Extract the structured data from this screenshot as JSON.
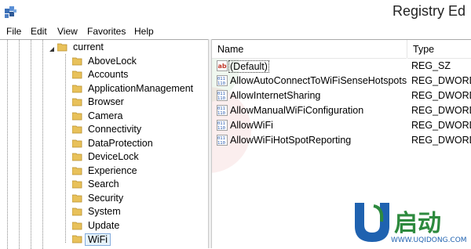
{
  "window": {
    "title": "Registry Ed"
  },
  "menu": {
    "items": [
      "File",
      "Edit",
      "View",
      "Favorites",
      "Help"
    ]
  },
  "tree": {
    "parent": "current",
    "children": [
      "AboveLock",
      "Accounts",
      "ApplicationManagement",
      "Browser",
      "Camera",
      "Connectivity",
      "DataProtection",
      "DeviceLock",
      "Experience",
      "Search",
      "Security",
      "System",
      "Update",
      "WiFi"
    ],
    "selected": "WiFi"
  },
  "list": {
    "headers": {
      "name": "Name",
      "type": "Type"
    },
    "rows": [
      {
        "name": "(Default)",
        "type": "REG_SZ",
        "icon": "string-value-icon"
      },
      {
        "name": "AllowAutoConnectToWiFiSenseHotspots",
        "type": "REG_DWORD",
        "icon": "dword-value-icon"
      },
      {
        "name": "AllowInternetSharing",
        "type": "REG_DWORD",
        "icon": "dword-value-icon"
      },
      {
        "name": "AllowManualWiFiConfiguration",
        "type": "REG_DWORD",
        "icon": "dword-value-icon"
      },
      {
        "name": "AllowWiFi",
        "type": "REG_DWORD",
        "icon": "dword-value-icon"
      },
      {
        "name": "AllowWiFiHotSpotReporting",
        "type": "REG_DWORD",
        "icon": "dword-value-icon"
      }
    ]
  },
  "watermark": {
    "brand": "U启动",
    "url": "WWW.UQIDONG.COM"
  },
  "colors": {
    "folder": "#e8c15a",
    "selection": "#e5f3fb",
    "selection_border": "#84acdd",
    "logo_blue": "#1f62b0",
    "logo_green": "#2d8a3e"
  }
}
